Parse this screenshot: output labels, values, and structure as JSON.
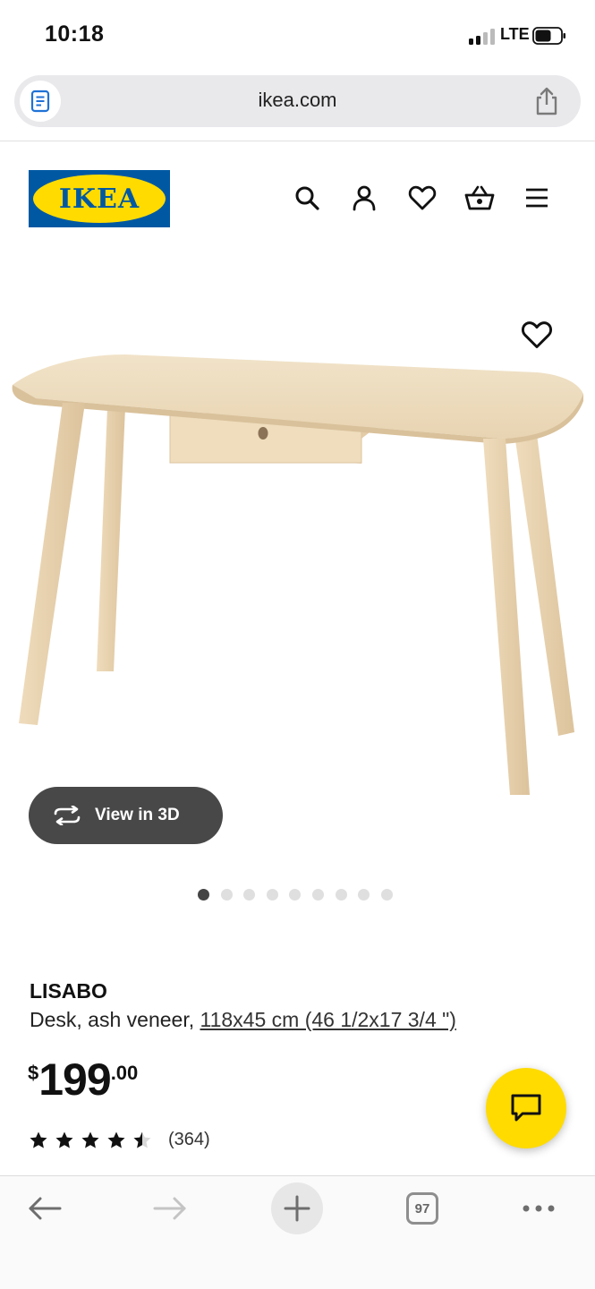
{
  "status_bar": {
    "time": "10:18",
    "network": "LTE"
  },
  "browser": {
    "url": "ikea.com",
    "tabs_count": "97",
    "icons": [
      "reader-icon",
      "share-icon",
      "back-icon",
      "forward-icon",
      "new-tab-icon",
      "tabs-icon",
      "more-icon"
    ]
  },
  "header": {
    "logo_text": "IKEA",
    "icons": [
      "search-icon",
      "account-icon",
      "heart-icon",
      "basket-icon",
      "menu-icon"
    ]
  },
  "gallery": {
    "view_3d_label": "View in 3D",
    "image_count": 9,
    "active_index": 0
  },
  "product": {
    "name": "LISABO",
    "description": "Desk, ash veneer, ",
    "measurements": "118x45 cm (46 1/2x17 3/4 \")",
    "price_currency": "$",
    "price_integer": "199",
    "price_decimal": ".00",
    "rating_value": 4.5,
    "rating_max": 5,
    "rating_count": "(364)"
  },
  "colors": {
    "ikea_blue": "#0058a3",
    "ikea_yellow": "#ffdb00",
    "view3d_bg": "#484848",
    "wood": "#ecd8b6"
  }
}
